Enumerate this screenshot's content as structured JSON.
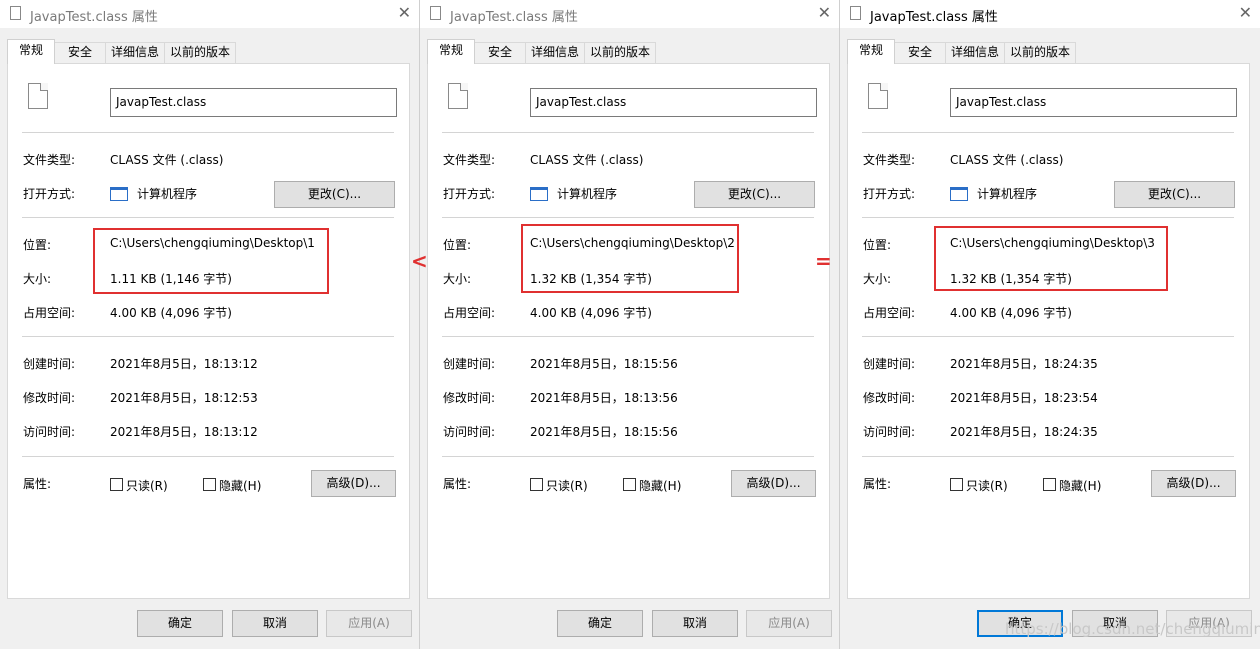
{
  "windows": [
    {
      "title": "JavapTest.class 属性",
      "tabs": [
        "常规",
        "安全",
        "详细信息",
        "以前的版本"
      ],
      "filename": "JavapTest.class",
      "fields": {
        "type_label": "文件类型:",
        "type_value": "CLASS 文件 (.class)",
        "open_label": "打开方式:",
        "open_value": "计算机程序",
        "change_btn": "更改(C)...",
        "loc_label": "位置:",
        "loc_value": "C:\\Users\\chengqiuming\\Desktop\\1",
        "size_label": "大小:",
        "size_value": "1.11 KB (1,146 字节)",
        "disk_label": "占用空间:",
        "disk_value": "4.00 KB (4,096 字节)",
        "created_label": "创建时间:",
        "created_value": "2021年8月5日，18:13:12",
        "modified_label": "修改时间:",
        "modified_value": "2021年8月5日，18:12:53",
        "accessed_label": "访问时间:",
        "accessed_value": "2021年8月5日，18:13:12",
        "attr_label": "属性:",
        "readonly_label": "只读(R)",
        "hidden_label": "隐藏(H)",
        "advanced_btn": "高级(D)..."
      },
      "footer": {
        "ok": "确定",
        "cancel": "取消",
        "apply": "应用(A)"
      }
    },
    {
      "title": "JavapTest.class 属性",
      "tabs": [
        "常规",
        "安全",
        "详细信息",
        "以前的版本"
      ],
      "filename": "JavapTest.class",
      "fields": {
        "type_label": "文件类型:",
        "type_value": "CLASS 文件 (.class)",
        "open_label": "打开方式:",
        "open_value": "计算机程序",
        "change_btn": "更改(C)...",
        "loc_label": "位置:",
        "loc_value": "C:\\Users\\chengqiuming\\Desktop\\2",
        "size_label": "大小:",
        "size_value": "1.32 KB (1,354 字节)",
        "disk_label": "占用空间:",
        "disk_value": "4.00 KB (4,096 字节)",
        "created_label": "创建时间:",
        "created_value": "2021年8月5日，18:15:56",
        "modified_label": "修改时间:",
        "modified_value": "2021年8月5日，18:13:56",
        "accessed_label": "访问时间:",
        "accessed_value": "2021年8月5日，18:15:56",
        "attr_label": "属性:",
        "readonly_label": "只读(R)",
        "hidden_label": "隐藏(H)",
        "advanced_btn": "高级(D)..."
      },
      "footer": {
        "ok": "确定",
        "cancel": "取消",
        "apply": "应用(A)"
      }
    },
    {
      "title": "JavapTest.class 属性",
      "tabs": [
        "常规",
        "安全",
        "详细信息",
        "以前的版本"
      ],
      "filename": "JavapTest.class",
      "fields": {
        "type_label": "文件类型:",
        "type_value": "CLASS 文件 (.class)",
        "open_label": "打开方式:",
        "open_value": "计算机程序",
        "change_btn": "更改(C)...",
        "loc_label": "位置:",
        "loc_value": "C:\\Users\\chengqiuming\\Desktop\\3",
        "size_label": "大小:",
        "size_value": "1.32 KB (1,354 字节)",
        "disk_label": "占用空间:",
        "disk_value": "4.00 KB (4,096 字节)",
        "created_label": "创建时间:",
        "created_value": "2021年8月5日，18:24:35",
        "modified_label": "修改时间:",
        "modified_value": "2021年8月5日，18:23:54",
        "accessed_label": "访问时间:",
        "accessed_value": "2021年8月5日，18:24:35",
        "attr_label": "属性:",
        "readonly_label": "只读(R)",
        "hidden_label": "隐藏(H)",
        "advanced_btn": "高级(D)..."
      },
      "footer": {
        "ok": "确定",
        "cancel": "取消",
        "apply": "应用(A)"
      }
    }
  ],
  "annotations": {
    "compare_1_2": "<",
    "compare_2_3": "="
  },
  "watermark": "https://blog.csdn.net/chengqiuming",
  "colors": {
    "highlight": "#e03030",
    "focus": "#0078d7"
  }
}
